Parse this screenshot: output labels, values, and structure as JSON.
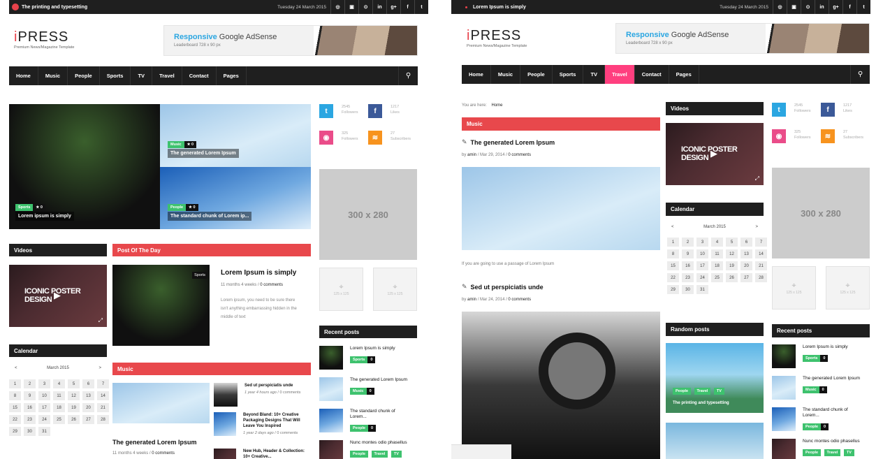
{
  "topbar": {
    "title_left": "The printing and typesetting",
    "title_right": "Lorem Ipsum is simply",
    "date": "Tuesday 24 March 2015",
    "social": [
      "◎",
      "▣",
      "⊙",
      "in",
      "g+",
      "f",
      "t"
    ]
  },
  "logo": {
    "name_i": "i",
    "name": "PRESS",
    "tagline": "Premium News/Magazine Template"
  },
  "ad": {
    "responsive": "Responsive",
    "rest": " Google AdSense",
    "sub": "Leaderboard 728 x 90 px"
  },
  "nav": {
    "items": [
      "Home",
      "Music",
      "People",
      "Sports",
      "TV",
      "Travel",
      "Contact",
      "Pages"
    ],
    "active_right": "Travel"
  },
  "featured": {
    "big": {
      "tag": "Sports",
      "stars": "★ 0",
      "title": "Lorem ipsum is simply"
    },
    "top": {
      "tag": "Music",
      "stars": "★ 0",
      "title": "The generated Lorem Ipsum"
    },
    "bottom": {
      "tag": "People",
      "stars": "★ 0",
      "title": "The standard chunk of Lorem ip..."
    }
  },
  "social_counts": [
    {
      "icon": "t",
      "count": "2545",
      "label": "Followers",
      "color": "#2ba6e1"
    },
    {
      "icon": "f",
      "count": "1217",
      "label": "Likes",
      "color": "#3b5998"
    },
    {
      "icon": "◉",
      "count": "325",
      "label": "Followers",
      "color": "#ea4c89"
    },
    {
      "icon": "≋",
      "count": "27",
      "label": "Subscribers",
      "color": "#f7931e"
    }
  ],
  "ads": {
    "big": "300 x 280",
    "small": "125 x 125"
  },
  "videos": {
    "heading": "Videos",
    "poster_text": "ICONIC POSTER DESIGN"
  },
  "calendar": {
    "heading": "Calendar",
    "month": "March 2015",
    "prev": "<",
    "next": ">",
    "days": [
      "1",
      "2",
      "3",
      "4",
      "5",
      "6",
      "7",
      "8",
      "9",
      "10",
      "11",
      "12",
      "13",
      "14",
      "15",
      "16",
      "17",
      "18",
      "19",
      "20",
      "21",
      "22",
      "23",
      "24",
      "25",
      "26",
      "27",
      "28",
      "29",
      "30",
      "31"
    ]
  },
  "potd": {
    "heading": "Post Of The Day",
    "tag": "Sports",
    "title": "Lorem Ipsum is simply",
    "meta_time": "11 months 4 weeks",
    "meta_sep": " / ",
    "meta_comments": "0 comments",
    "excerpt": "Lorem ipsum, you need to be sure there isn't anything embarrassing hidden in the middle of text"
  },
  "music": {
    "heading": "Music",
    "main_title": "The generated Lorem Ipsum",
    "main_meta_time": "11 months 4 weeks",
    "main_meta_comments": "0 comments",
    "list": [
      {
        "title": "Sed ut perspiciatis unde",
        "time": "1 year 4 hours ago",
        "comments": "0 comments"
      },
      {
        "title": "Beyond Bland: 10+ Creative Packaging Designs That Will Leave You Inspired",
        "time": "1 year 2 days ago",
        "comments": "0 comments"
      },
      {
        "title": "New Hub, Header & Collection: 10+ Creative...",
        "time": "",
        "comments": ""
      }
    ]
  },
  "recent": {
    "heading": "Recent posts",
    "items": [
      {
        "title": "Lorem Ipsum is simply",
        "tags": [
          "Sports"
        ],
        "count": "0"
      },
      {
        "title": "The generated Lorem Ipsum",
        "tags": [
          "Music"
        ],
        "count": "0"
      },
      {
        "title": "The standard chunk of Lorem...",
        "tags": [
          "People"
        ],
        "count": "0"
      },
      {
        "title": "Nunc montes odio phasellus",
        "tags": [
          "People",
          "Travel",
          "TV"
        ],
        "count": "0"
      }
    ]
  },
  "breadcrumb": {
    "label": "You are here:",
    "home": "Home"
  },
  "category": {
    "heading": "Music",
    "posts": [
      {
        "title": "The generated Lorem Ipsum",
        "author": "amin",
        "date": "Mar 29, 2014",
        "comments": "0 comments",
        "excerpt": "If you are going to use a passage of Lorem Ipsum"
      },
      {
        "title": "Sed ut perspiciatis unde",
        "author": "amin",
        "date": "Mar 24, 2014",
        "comments": "0 comments"
      }
    ]
  },
  "random": {
    "heading": "Random posts",
    "tags": [
      "People",
      "Travel",
      "TV"
    ],
    "title": "The printing and typesetting"
  }
}
